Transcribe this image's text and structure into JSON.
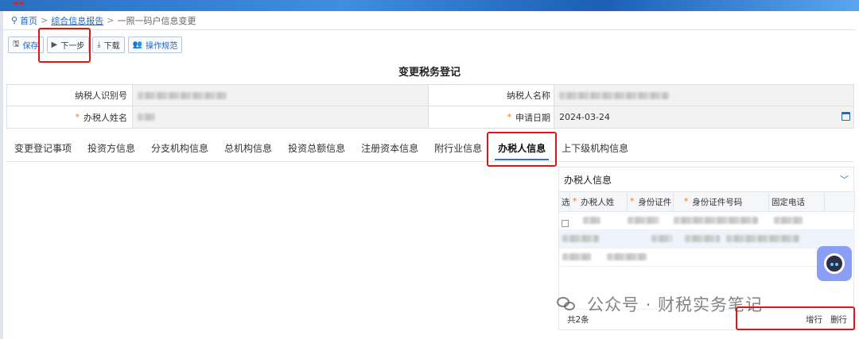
{
  "breadcrumb": {
    "home": "首页",
    "parent": "综合信息报告",
    "current": "一照一码户信息变更",
    "sep": ">"
  },
  "toolbar": {
    "save": "保存",
    "next": "下一步",
    "download": "下载",
    "guide": "操作规范"
  },
  "form": {
    "title": "变更税务登记",
    "taxpayer_id_label": "纳税人识别号",
    "taxpayer_name_label": "纳税人名称",
    "handler_name_label": "办税人姓名",
    "apply_date_label": "申请日期",
    "apply_date_value": "2024-03-24",
    "required_mark": "*"
  },
  "tabs": [
    {
      "label": "变更登记事项",
      "active": false
    },
    {
      "label": "投资方信息",
      "active": false
    },
    {
      "label": "分支机构信息",
      "active": false
    },
    {
      "label": "总机构信息",
      "active": false
    },
    {
      "label": "投资总额信息",
      "active": false
    },
    {
      "label": "注册资本信息",
      "active": false
    },
    {
      "label": "附行业信息",
      "active": false
    },
    {
      "label": "办税人信息",
      "active": true
    },
    {
      "label": "上下级机构信息",
      "active": false
    }
  ],
  "panel": {
    "title": "办税人信息",
    "columns": [
      "选",
      "办税人姓",
      "身份证件",
      "身份证件号码",
      "固定电话"
    ],
    "footer_count": "共2条",
    "add_row": "增行",
    "delete_row": "删行"
  },
  "watermark": {
    "text": "公众号 · 财税实务笔记"
  },
  "colors": {
    "accent": "#1e66c8",
    "highlight": "#e01414",
    "required": "#e8762c",
    "tab_underline": "#2f6fd6"
  }
}
